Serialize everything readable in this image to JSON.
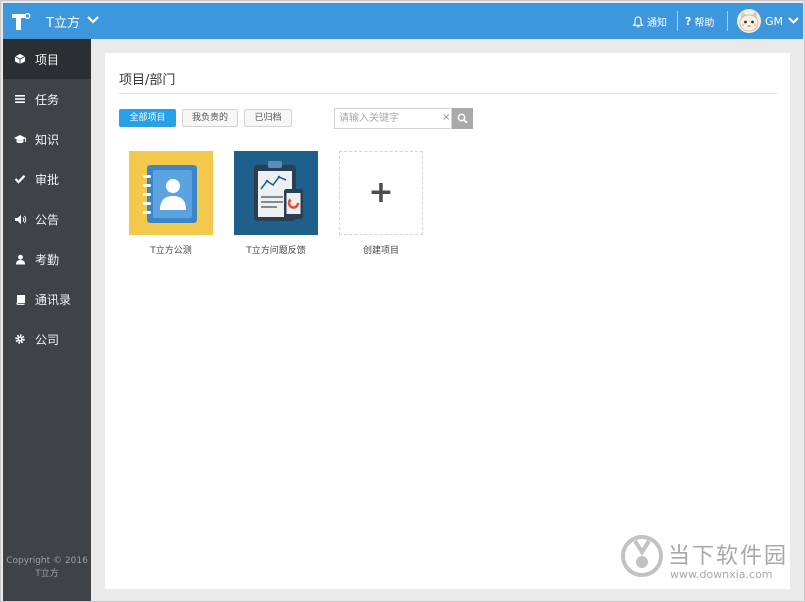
{
  "app": {
    "title": "T立方"
  },
  "topbar": {
    "notifications_label": "通知",
    "help_label": "帮助",
    "user_name": "GM"
  },
  "sidebar": {
    "items": [
      {
        "label": "项目",
        "icon": "cube-icon",
        "active": true
      },
      {
        "label": "任务",
        "icon": "list-icon"
      },
      {
        "label": "知识",
        "icon": "graduation-cap-icon"
      },
      {
        "label": "审批",
        "icon": "check-icon"
      },
      {
        "label": "公告",
        "icon": "megaphone-icon"
      },
      {
        "label": "考勤",
        "icon": "user-icon"
      },
      {
        "label": "通讯录",
        "icon": "book-icon"
      },
      {
        "label": "公司",
        "icon": "gear-icon"
      }
    ],
    "copyright_line1": "Copyright © 2016",
    "copyright_line2": "T立方"
  },
  "main": {
    "title": "项目/部门",
    "filters": [
      {
        "label": "全部项目",
        "active": true
      },
      {
        "label": "我负责的"
      },
      {
        "label": "已归档"
      }
    ],
    "search": {
      "placeholder": "请输入关键字",
      "clear": "×"
    },
    "projects": [
      {
        "name": "T立方公测",
        "icon": "contacts-book-icon",
        "color": "#f2c94c"
      },
      {
        "name": "T立方问题反馈",
        "icon": "clipboard-chart-icon",
        "color": "#1f5f8b"
      }
    ],
    "create_label": "创建项目",
    "create_symbol": "+"
  },
  "watermark": {
    "text": "当下软件园",
    "url": "www.downxia.com"
  },
  "colors": {
    "topbar": "#3e96dd",
    "sidebar": "#3f4347",
    "accent": "#27a0e5"
  }
}
